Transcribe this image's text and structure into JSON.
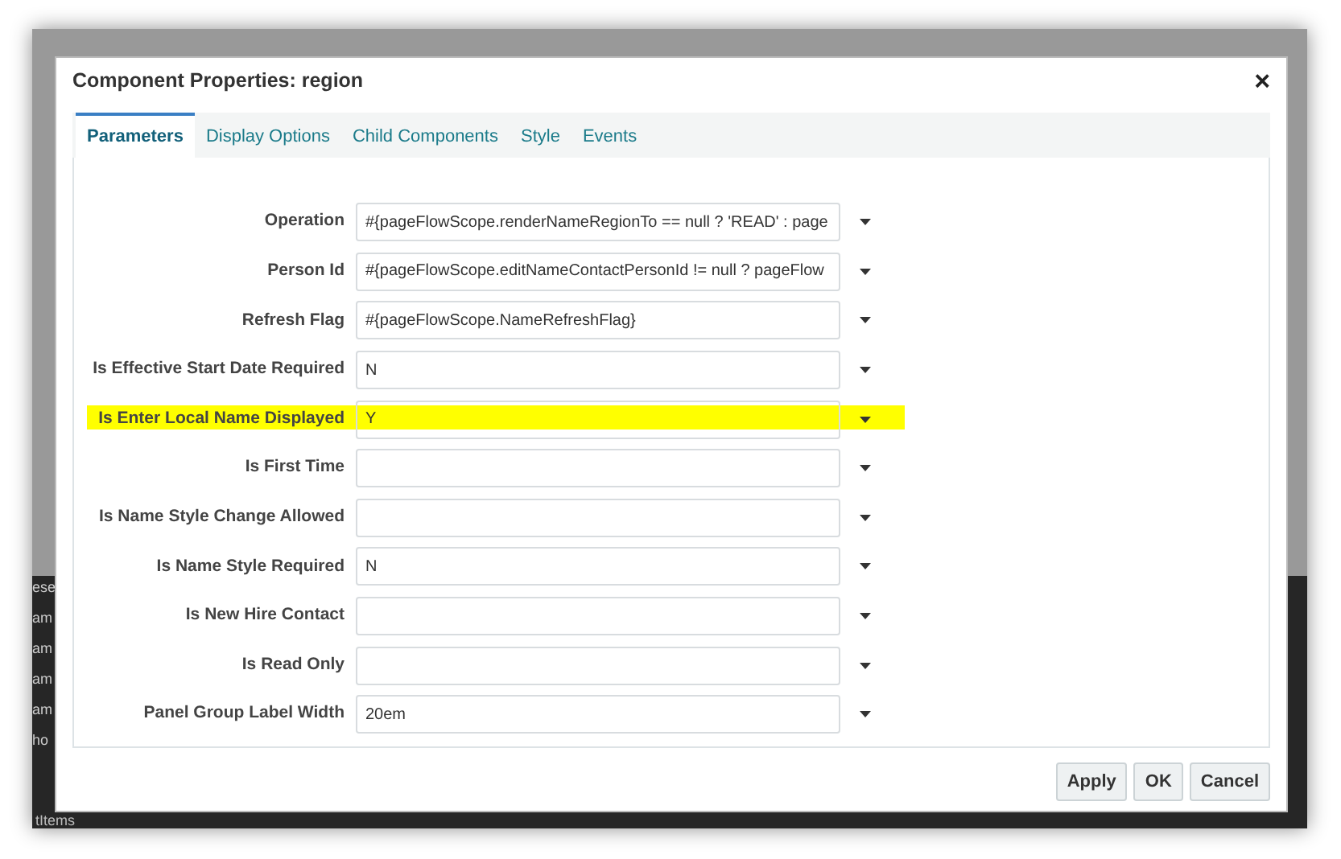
{
  "background": {
    "side_fragments": [
      "ese",
      "am",
      "am",
      "am",
      "am",
      "ho"
    ],
    "bottom_fragment": "tItems"
  },
  "dialog": {
    "title": "Component Properties: region",
    "close": "×"
  },
  "tabs": [
    {
      "label": "Parameters",
      "selected": true
    },
    {
      "label": "Display Options",
      "selected": false
    },
    {
      "label": "Child Components",
      "selected": false
    },
    {
      "label": "Style",
      "selected": false
    },
    {
      "label": "Events",
      "selected": false
    }
  ],
  "parameters": [
    {
      "label": "Operation",
      "value": "#{pageFlowScope.renderNameRegionTo == null ? 'READ' : page",
      "highlighted": false
    },
    {
      "label": "Person Id",
      "value": "#{pageFlowScope.editNameContactPersonId != null ? pageFlow",
      "highlighted": false
    },
    {
      "label": "Refresh Flag",
      "value": "#{pageFlowScope.NameRefreshFlag}",
      "highlighted": false
    },
    {
      "label": "Is Effective Start Date Required",
      "value": "N",
      "highlighted": false
    },
    {
      "label": "Is Enter Local Name Displayed",
      "value": "Y",
      "highlighted": true
    },
    {
      "label": "Is First Time",
      "highlighted": false
    },
    {
      "label": "Is Name Style Change Allowed",
      "highlighted": false
    },
    {
      "label": "Is Name Style Required",
      "value": "N",
      "highlighted": false
    },
    {
      "label": "Is New Hire Contact",
      "highlighted": false
    },
    {
      "label": "Is Read Only",
      "highlighted": false
    },
    {
      "label": "Panel Group Label Width",
      "value": "20em",
      "highlighted": false
    }
  ],
  "buttons": [
    "Apply",
    "OK",
    "Cancel"
  ]
}
